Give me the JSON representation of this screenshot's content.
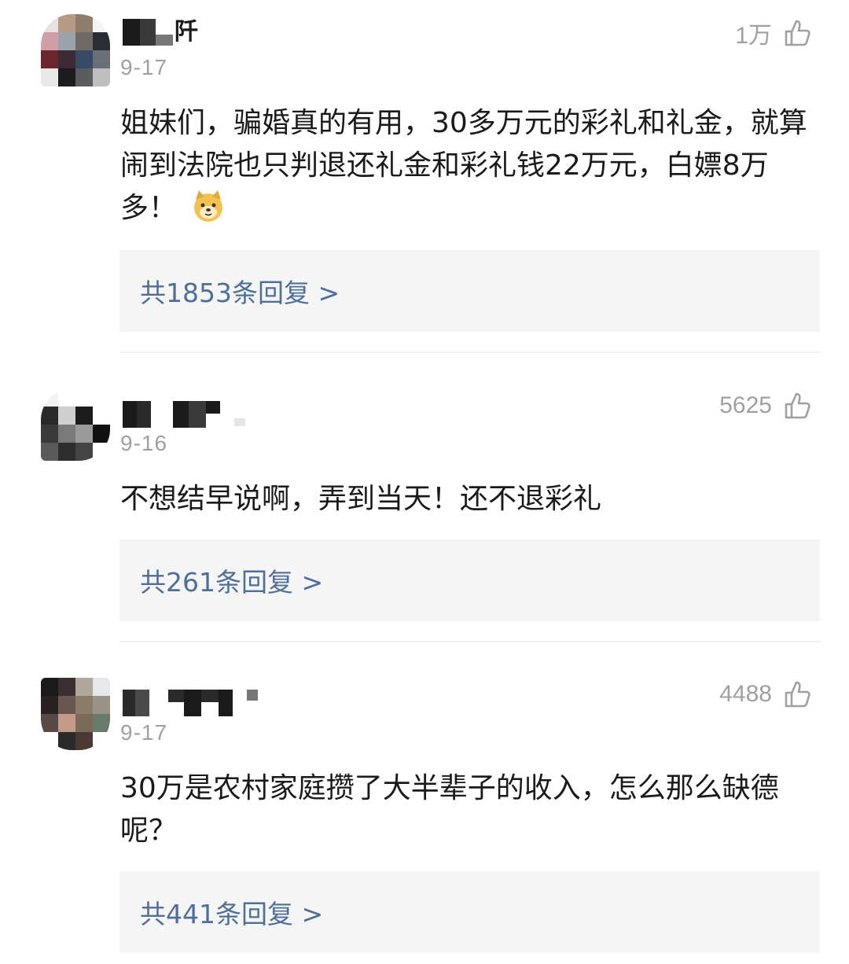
{
  "comments": [
    {
      "username_suffix": "阡",
      "time": "9-17",
      "likes": "1万",
      "text": "姐妹们，骗婚真的有用，30多万元的彩礼和礼金，就算闹到法院也只判退还礼金和彩礼钱22万元，白嫖8万多！",
      "emoji": "doge-emoji",
      "replies": "共1853条回复 >"
    },
    {
      "username_suffix": "",
      "time": "9-16",
      "likes": "5625",
      "text": "不想结早说啊，弄到当天！还不退彩礼",
      "replies": "共261条回复 >"
    },
    {
      "username_suffix": "",
      "time": "9-17",
      "likes": "4488",
      "text": "30万是农村家庭攒了大半辈子的收入，怎么那么缺德呢？",
      "replies": "共441条回复 >"
    }
  ],
  "icons": {
    "like": "thumbs-up-icon"
  },
  "colors": {
    "reply_link": "#4e6f9a",
    "meta_gray": "#a0a0a0",
    "reply_bg": "#f5f5f5"
  }
}
